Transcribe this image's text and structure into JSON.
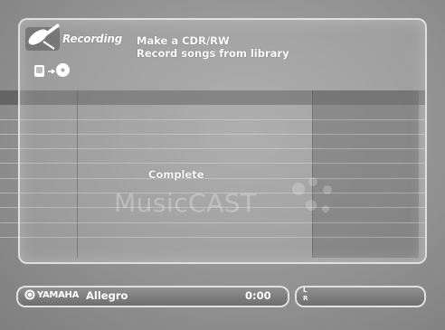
{
  "header": {
    "mode_title": "Recording",
    "menu_items": [
      "Make a CDR/RW",
      "Record songs from library"
    ]
  },
  "status": {
    "message": "Complete"
  },
  "watermark": "MusicCAST",
  "playbar": {
    "brand": "YAMAHA",
    "station": "Allegro",
    "time": "0:00"
  },
  "levels": {
    "left_label": "L",
    "right_label": "R",
    "left_level": 0,
    "right_level": 0
  },
  "icons": {
    "mode": "recording-satellite-icon",
    "source": "hdd-icon",
    "arrow": "arrow-icon",
    "target": "cd-icon",
    "brand": "yamaha-logo-icon"
  }
}
